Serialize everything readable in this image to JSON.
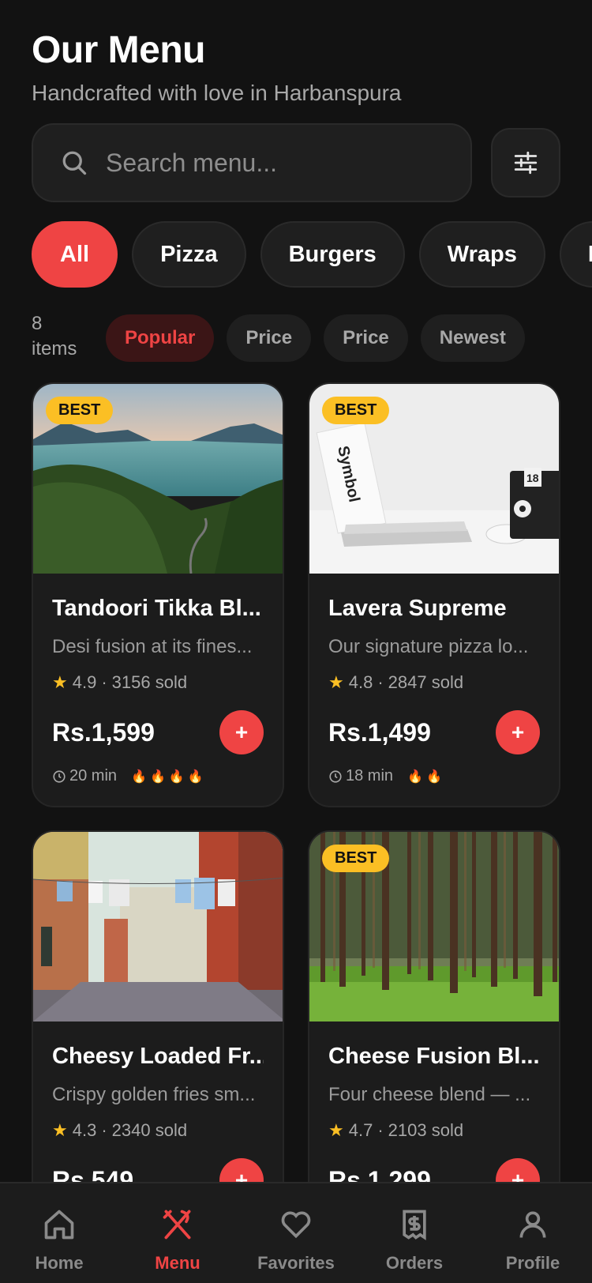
{
  "header": {
    "title": "Our Menu",
    "subtitle": "Handcrafted with love in Harbanspura"
  },
  "search": {
    "placeholder": "Search menu..."
  },
  "categories": [
    "All",
    "Pizza",
    "Burgers",
    "Wraps",
    "Loa"
  ],
  "list": {
    "count_number": "8",
    "count_label": "items",
    "sorts": [
      "Popular",
      "Price",
      "Price",
      "Newest"
    ]
  },
  "items": [
    {
      "badge": "BEST",
      "name": "Tandoori Tikka Bl...",
      "desc": "Desi fusion at its fines...",
      "rating": "4.9",
      "sold": "3156 sold",
      "price": "Rs.1,599",
      "time": "20 min",
      "spice_level": 4
    },
    {
      "badge": "BEST",
      "name": "Lavera Supreme",
      "desc": "Our signature pizza lo...",
      "rating": "4.8",
      "sold": "2847 sold",
      "price": "Rs.1,499",
      "time": "18 min",
      "spice_level": 2,
      "image_text": [
        "Symbol",
        "18"
      ]
    },
    {
      "name": "Cheesy Loaded Fr...",
      "desc": "Crispy golden fries sm...",
      "rating": "4.3",
      "sold": "2340 sold",
      "price": "Rs.549"
    },
    {
      "badge": "BEST",
      "name": "Cheese Fusion Bl...",
      "desc": "Four cheese blend — ...",
      "rating": "4.7",
      "sold": "2103 sold",
      "price": "Rs.1,299"
    }
  ],
  "add_label": "+",
  "rating_separator": "·",
  "nav": [
    "Home",
    "Menu",
    "Favorites",
    "Orders",
    "Profile"
  ],
  "colors": {
    "background": "#121212",
    "accent": "#ef4444",
    "badge": "#fbbf24",
    "card": "#1c1c1c"
  },
  "icons": {
    "search": "search-icon",
    "filter": "sliders-icon",
    "star": "star-icon",
    "clock": "clock-icon",
    "spice": "flame-icon",
    "nav": [
      "home-icon",
      "utensils-icon",
      "heart-icon",
      "receipt-icon",
      "user-icon"
    ]
  }
}
